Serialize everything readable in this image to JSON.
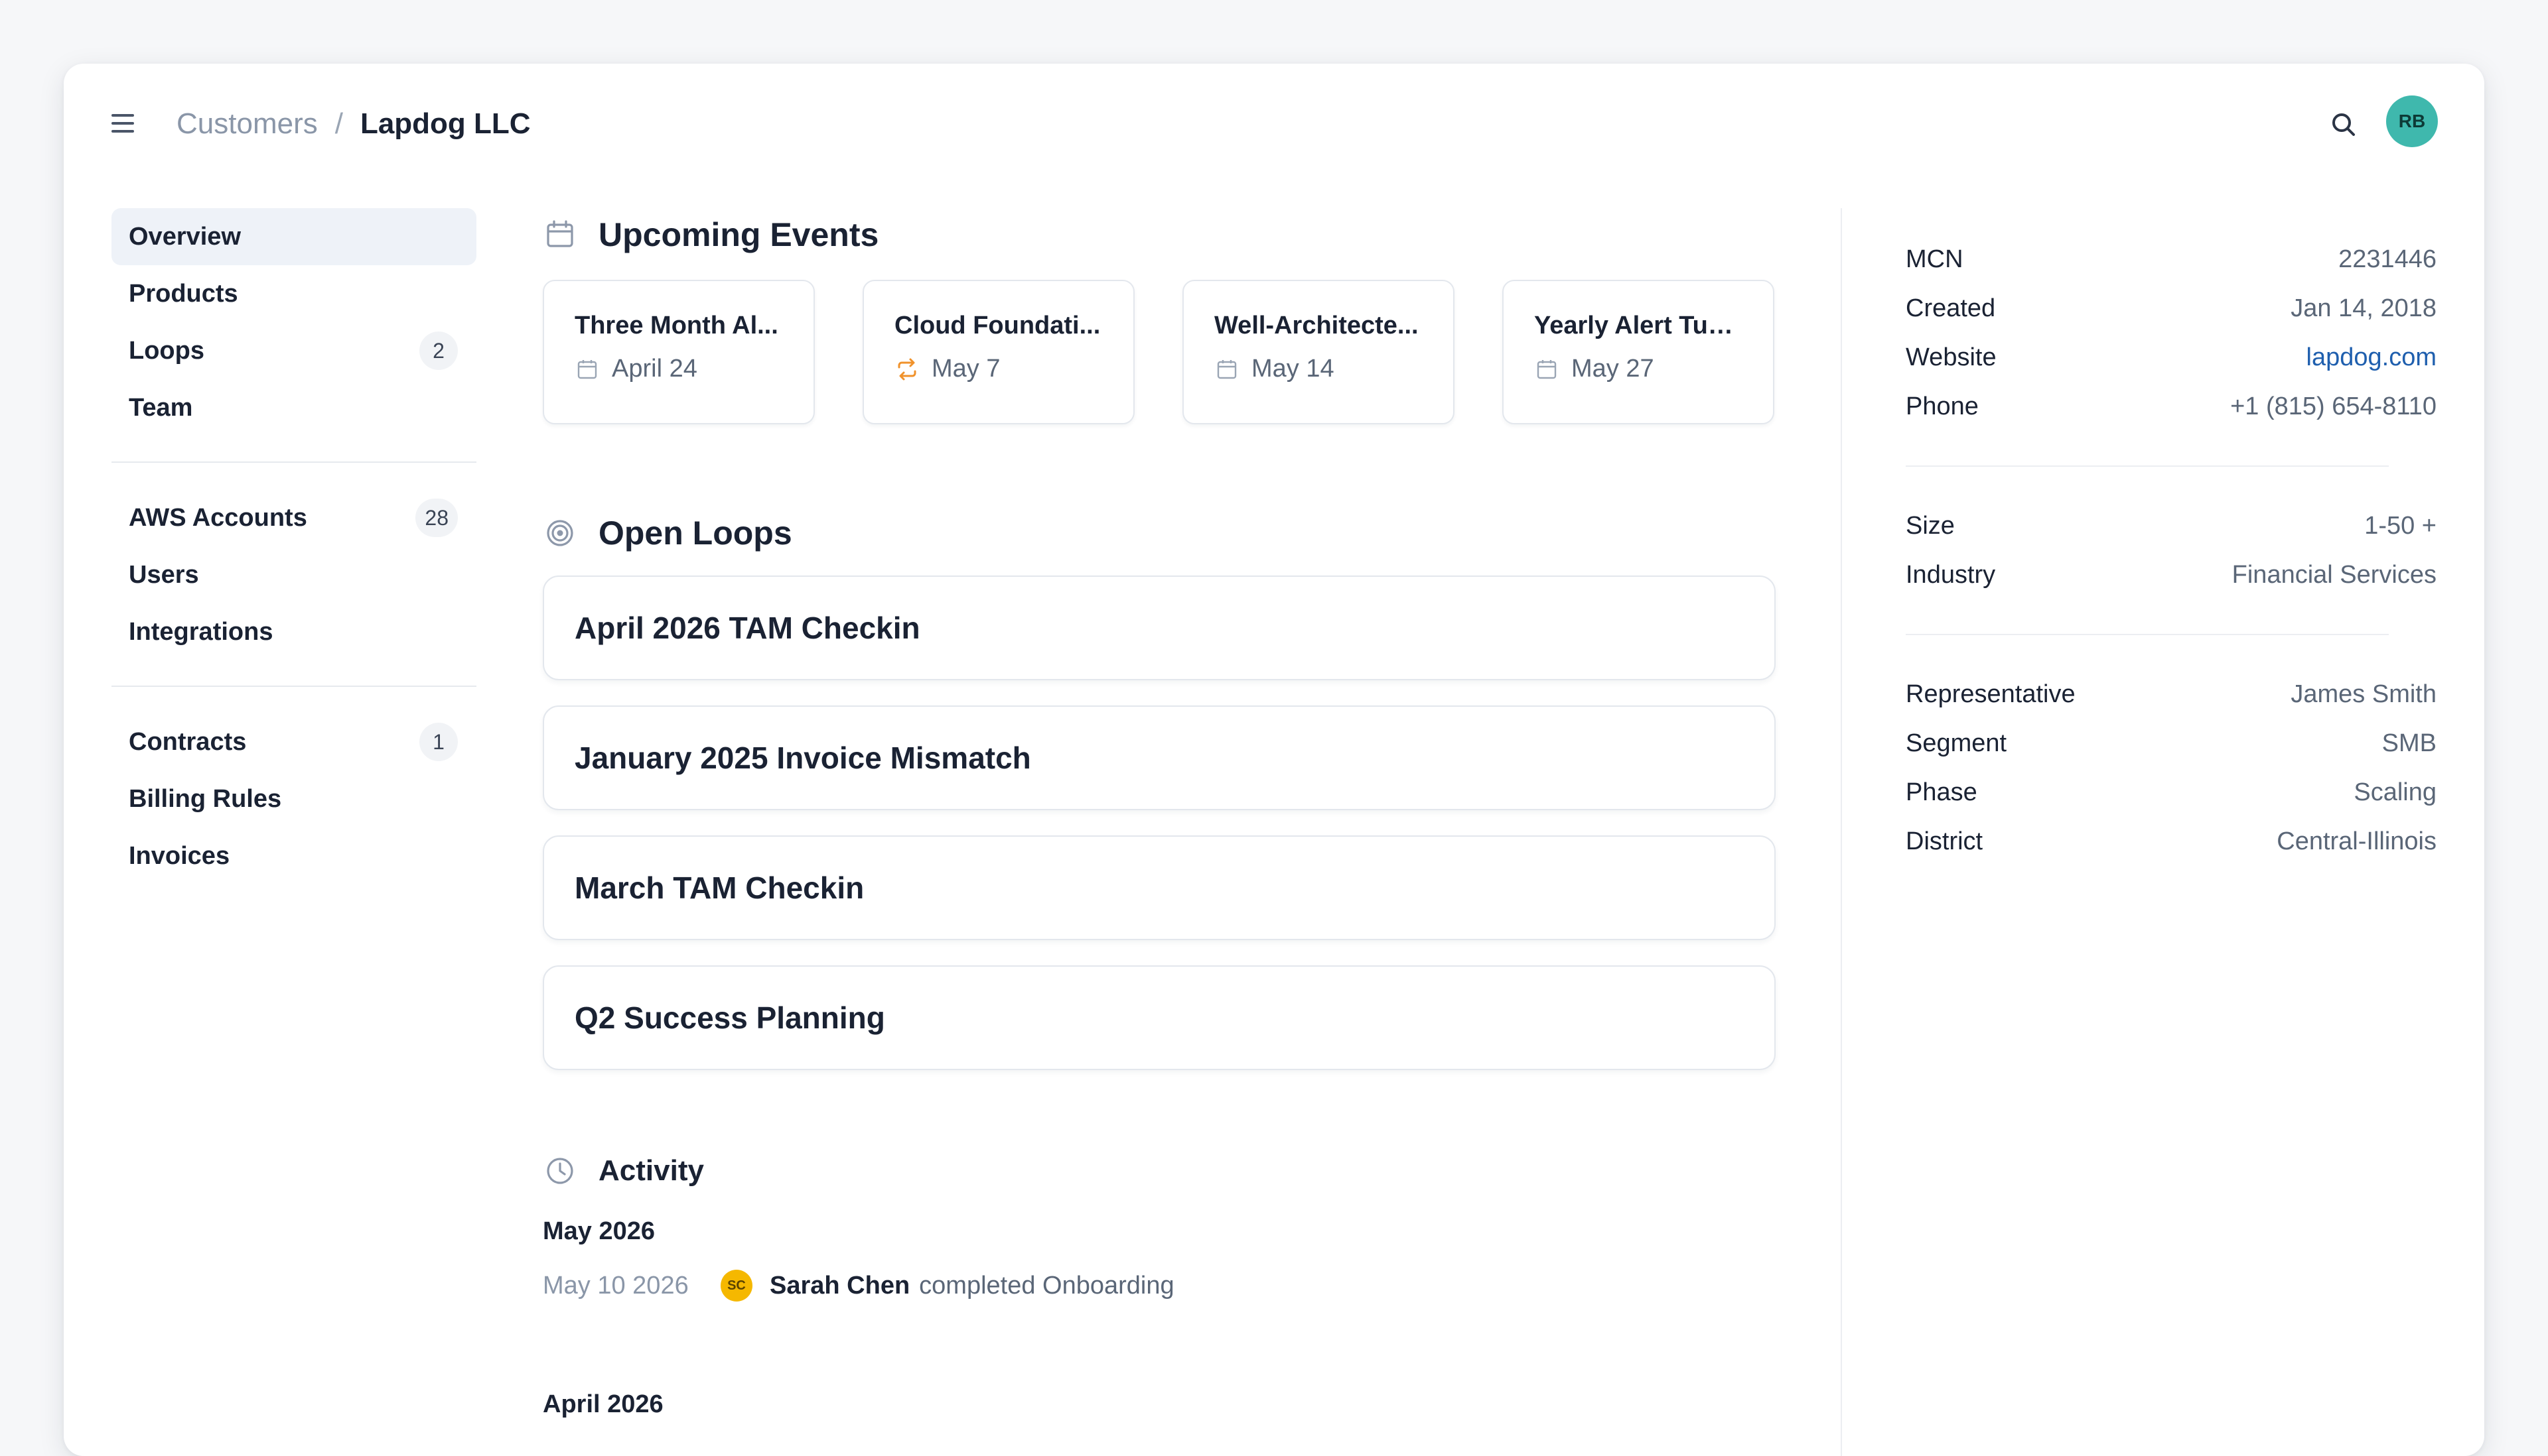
{
  "header": {
    "breadcrumb_root": "Customers",
    "breadcrumb_sep": "/",
    "breadcrumb_current": "Lapdog LLC",
    "avatar_initials": "RB",
    "avatar_color": "#3fb8ad"
  },
  "sidebar": {
    "groups": [
      [
        {
          "label": "Overview",
          "badge": null,
          "active": true
        },
        {
          "label": "Products",
          "badge": null
        },
        {
          "label": "Loops",
          "badge": "2"
        },
        {
          "label": "Team",
          "badge": null
        }
      ],
      [
        {
          "label": "AWS Accounts",
          "badge": "28"
        },
        {
          "label": "Users",
          "badge": null
        },
        {
          "label": "Integrations",
          "badge": null
        }
      ],
      [
        {
          "label": "Contracts",
          "badge": "1"
        },
        {
          "label": "Billing Rules",
          "badge": null
        },
        {
          "label": "Invoices",
          "badge": null
        }
      ]
    ]
  },
  "events": {
    "title": "Upcoming Events",
    "items": [
      {
        "title": "Three Month Al...",
        "date": "April 24",
        "icon": "calendar-icon"
      },
      {
        "title": "Cloud Foundati...",
        "date": "May 7",
        "icon": "repeat-icon"
      },
      {
        "title": "Well-Architecte...",
        "date": "May 14",
        "icon": "calendar-icon"
      },
      {
        "title": "Yearly Alert Tun...",
        "date": "May 27",
        "icon": "calendar-icon"
      }
    ]
  },
  "loops": {
    "title": "Open Loops",
    "items": [
      "April 2026 TAM Checkin",
      "January 2025 Invoice Mismatch",
      "March TAM Checkin",
      "Q2 Success Planning"
    ]
  },
  "activity": {
    "title": "Activity",
    "month1": "May 2026",
    "entry": {
      "date": "May 10 2026",
      "initials": "SC",
      "user": "Sarah Chen",
      "text": "completed Onboarding"
    },
    "month2": "April 2026"
  },
  "details": {
    "mcn_label": "MCN",
    "mcn": "2231446",
    "created_label": "Created",
    "created": "Jan 14, 2018",
    "website_label": "Website",
    "website": "lapdog.com",
    "phone_label": "Phone",
    "phone": "+1 (815) 654-8110",
    "size_label": "Size",
    "size": "1-50 +",
    "industry_label": "Industry",
    "industry": "Financial Services",
    "rep_label": "Representative",
    "rep": "James Smith",
    "segment_label": "Segment",
    "segment": "SMB",
    "phase_label": "Phase",
    "phase": "Scaling",
    "district_label": "District",
    "district": "Central-Illinois"
  }
}
